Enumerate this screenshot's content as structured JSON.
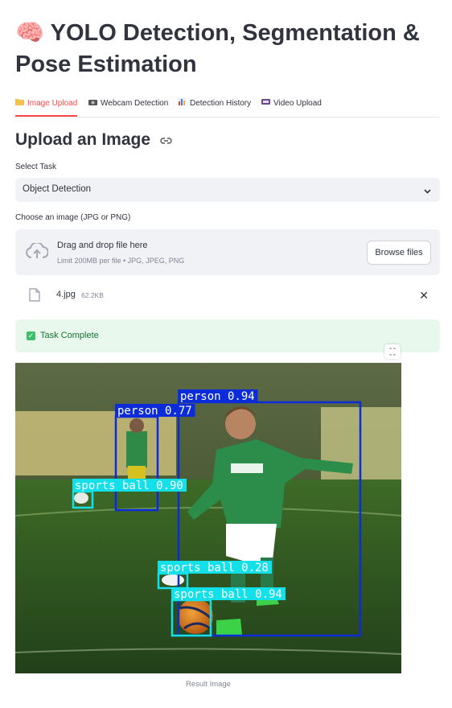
{
  "header": {
    "icon": "brain-icon",
    "title": "🧠 YOLO Detection, Segmentation & Pose Estimation"
  },
  "tabs": [
    {
      "label": "Image Upload",
      "icon": "folder-icon",
      "active": true
    },
    {
      "label": "Webcam Detection",
      "icon": "camera-icon",
      "active": false
    },
    {
      "label": "Detection History",
      "icon": "chart-icon",
      "active": false
    },
    {
      "label": "Video Upload",
      "icon": "video-icon",
      "active": false
    }
  ],
  "section": {
    "title": "Upload an Image"
  },
  "task": {
    "label": "Select Task",
    "value": "Object Detection"
  },
  "uploader": {
    "label": "Choose an image (JPG or PNG)",
    "drop_text": "Drag and drop file here",
    "limit_text": "Limit 200MB per file • JPG, JPEG, PNG",
    "browse_label": "Browse files"
  },
  "file": {
    "name": "4.jpg",
    "size": "62.2KB"
  },
  "status": {
    "message": "Task Complete",
    "color": "#177233"
  },
  "detections": [
    {
      "label": "person 0.94",
      "color": "#0b2cd8"
    },
    {
      "label": "person 0.77",
      "color": "#0b2cd8"
    },
    {
      "label": "sports ball 0.90",
      "color": "#13e0e8"
    },
    {
      "label": "sports ball 0.28",
      "color": "#13e0e8"
    },
    {
      "label": "sports ball 0.94",
      "color": "#13e0e8"
    }
  ],
  "result_caption": "Result Image",
  "colors": {
    "accent": "#ff4b4b",
    "text": "#31333f",
    "muted": "#808495",
    "success_bg": "#e8f8ec"
  }
}
